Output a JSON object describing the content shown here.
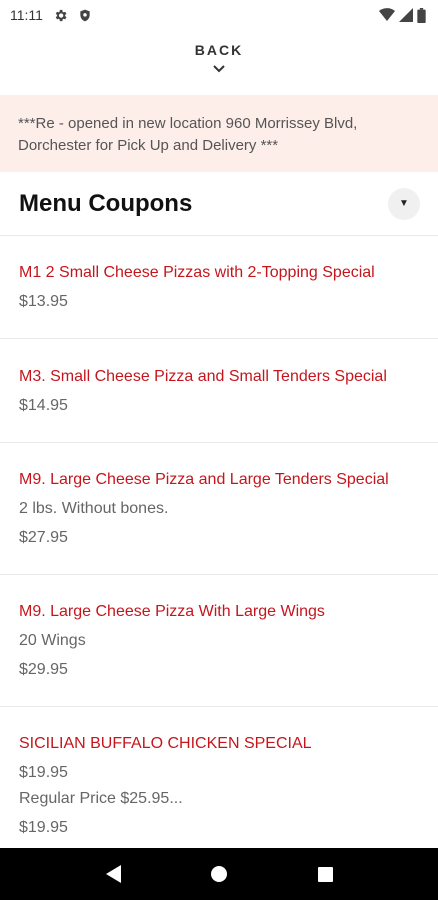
{
  "status": {
    "time": "11:11"
  },
  "back": {
    "label": "BACK"
  },
  "banner": {
    "text": "***Re - opened in new location 960 Morrissey Blvd, Dorchester for Pick Up and Delivery ***"
  },
  "section": {
    "title": "Menu Coupons",
    "toggle_glyph": "▼"
  },
  "items": [
    {
      "title": "M1 2 Small Cheese Pizzas with 2-Topping Special",
      "lines": [
        "$13.95"
      ]
    },
    {
      "title": "M3. Small Cheese Pizza and Small Tenders Special",
      "lines": [
        "$14.95"
      ]
    },
    {
      "title": "M9. Large Cheese Pizza and Large Tenders Special",
      "lines": [
        "2 lbs. Without bones.",
        "$27.95"
      ]
    },
    {
      "title": "M9. Large Cheese Pizza With Large Wings",
      "lines": [
        "20 Wings",
        "$29.95"
      ]
    },
    {
      "title": "SICILIAN BUFFALO CHICKEN SPECIAL",
      "lines": [
        "$19.95",
        "Regular Price $25.95...",
        "$19.95"
      ]
    }
  ],
  "icons": {
    "status": [
      "gear-icon",
      "shield-icon",
      "wifi-icon",
      "signal-icon",
      "battery-icon"
    ],
    "nav": [
      "back-triangle-icon",
      "home-circle-icon",
      "recents-square-icon"
    ],
    "back": "chevron-down-icon"
  },
  "colors": {
    "accent": "#c5161d",
    "banner_bg": "#fdeeea",
    "nav_bg": "#000000"
  }
}
